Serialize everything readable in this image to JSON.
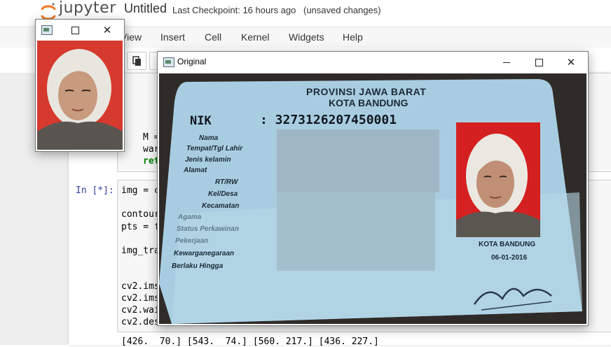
{
  "jupyter": {
    "logo_text": "jupyter",
    "notebook_title": "Untitled",
    "checkpoint": "Last Checkpoint: 16 hours ago",
    "status": "(unsaved changes)",
    "menu": [
      "View",
      "Insert",
      "Cell",
      "Kernel",
      "Widgets",
      "Help"
    ]
  },
  "cells": {
    "cell1_lines": [
      "M =",
      "war",
      "ret"
    ],
    "cell2_prompt": "In [*]:",
    "cell2_lines": [
      "img = c",
      "",
      "contour",
      "pts = f",
      "",
      "img_tra",
      "",
      "",
      "cv2.ims",
      "cv2.ims",
      "cv2.wai",
      "cv2.des"
    ],
    "cell2_tail": "()",
    "output_line": "[426.  70.] [543.  74.] [560. 217.] [436. 227.]"
  },
  "small_window": {
    "title": ""
  },
  "original_window": {
    "title": "Original"
  },
  "id_card": {
    "province": "PROVINSI JAWA BARAT",
    "city": "KOTA BANDUNG",
    "nik_label": "NIK",
    "nik_value": ": 3273126207450001",
    "fields": [
      "Nama",
      "Tempat/Tgl Lahir",
      "Jenis kelamin",
      "Alamat",
      "RT/RW",
      "Kel/Desa",
      "Kecamatan",
      "Agama",
      "Status Perkawinan",
      "Pekerjaan",
      "Kewarganegaraan",
      "Berlaku Hingga"
    ],
    "issue_city": "KOTA BANDUNG",
    "issue_date": "06-01-2016"
  },
  "colors": {
    "photo_background": "#d42020",
    "card_blue": "#a9cde0",
    "prompt_blue": "#303f9f"
  }
}
